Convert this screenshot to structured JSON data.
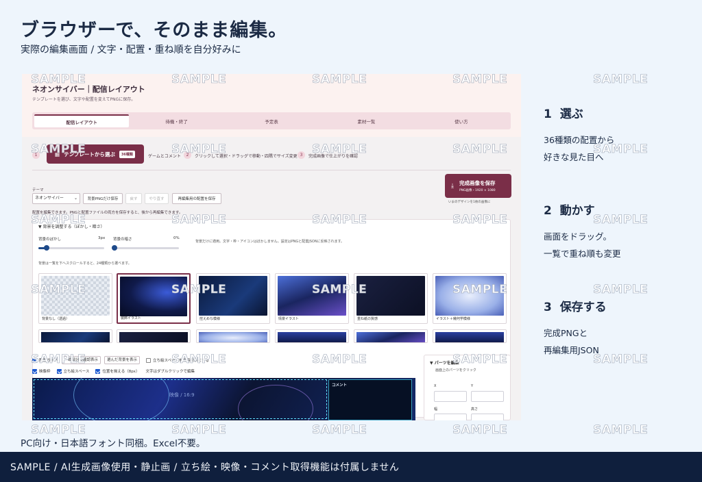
{
  "headline": "ブラウザーで、そのまま編集。",
  "subline": "実際の編集画面 / 文字・配置・重ね順を自分好みに",
  "app": {
    "title": "ネオンサイバー｜配信レイアウト",
    "desc": "テンプレートを選び、文字や配置を変えてPNGに保存。",
    "tabs": [
      "配信レイアウト",
      "待機・終了",
      "予定表",
      "素材一覧",
      "使い方"
    ],
    "template_button": "テンプレートから選ぶ",
    "template_count": "36種類",
    "steps": [
      "ゲームとコメント",
      "クリックして選択・ドラッグで移動・四隅でサイズ変更",
      "完成画像で仕上がりを確認"
    ],
    "step_nums": [
      "1",
      "2",
      "3"
    ],
    "theme_label": "テーマ",
    "theme_value": "ネオンサイバー",
    "buttons": {
      "save_bg_png": "背景PNGだけ保存",
      "undo": "戻す",
      "redo": "やり直す",
      "save_layout": "再編集用の配置を保存"
    },
    "save_final": {
      "label": "完成画像を保存",
      "sub": "PNG画像・1920 × 1080",
      "note": "いまのデザインを1枚の画像に"
    },
    "edit_note": "配置を編集できます。PNGと配置ファイルの両方を保存すると、後から再編集できます。",
    "bg_panel": {
      "summary": "▼ 背景を調整する（ぼかし・暗さ）",
      "blur_label": "背景のぼかし",
      "blur_value": "3px",
      "blur_fraction": 0.1,
      "dark_label": "背景の暗さ",
      "dark_value": "0%",
      "dark_fraction": 0.0,
      "note": "背景だけに適用。文字・枠・アイコンはぼかしません。設定はPNGと配置JSONに反映されます。",
      "hint": "背景は一覧を下へスクロールすると、24種類から選べます。",
      "thumbs": [
        "背景なし（透過）",
        "装飾イラスト",
        "控えめな模様",
        "情景イラスト",
        "重ね紙の質感",
        "イラスト＋幾何学模様"
      ]
    },
    "options": {
      "guide": "配置ガイド",
      "compare_select": "一致部分の確認表示",
      "bg_select": "選んだ背景を表示",
      "standing_space": "立ち絵スペースを常時表示にする",
      "video_frame": "映像枠",
      "standing": "立ち絵スペース",
      "align": "位置を揃える（8px）",
      "dblclick": "文字はダブルクリックで編集"
    },
    "canvas": {
      "video_label": "映像 / 16:9",
      "comment_label": "コメント"
    },
    "parts": {
      "title": "▼ パーツを編集",
      "hint": "画面上のパーツをクリック",
      "x": "X",
      "y": "Y",
      "w": "幅",
      "h": "高さ"
    }
  },
  "watermark": "SAMPLE",
  "side": [
    {
      "num": "1",
      "title": "選ぶ",
      "lines": [
        "36種類の配置から",
        "好きな見た目へ"
      ]
    },
    {
      "num": "2",
      "title": "動かす",
      "lines": [
        "画面をドラッグ。",
        "一覧で重ね順も変更"
      ]
    },
    {
      "num": "3",
      "title": "保存する",
      "lines": [
        "完成PNGと",
        "再編集用JSON"
      ]
    }
  ],
  "footnote": "PC向け・日本語フォント同梱。Excel不要。",
  "footer": "SAMPLE / AI生成画像使用・静止画 / 立ち絵・映像・コメント取得機能は付属しません",
  "colors": {
    "accent": "#7a2e48",
    "footer_bg": "#0f1f3d",
    "page_bg": "#eef5fc"
  }
}
